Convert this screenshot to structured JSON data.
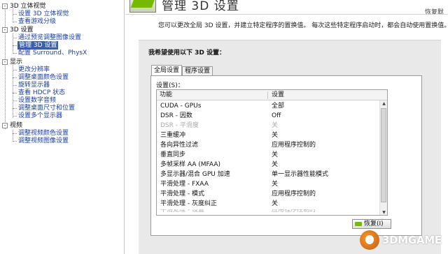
{
  "tree": {
    "categories": [
      {
        "label": "3D 立体视觉",
        "children": [
          "设置 3D 立体视觉",
          "查看游戏分级"
        ]
      },
      {
        "label": "3D 设置",
        "children": [
          "通过预览调整图像设置",
          "管理 3D 设置",
          "配置 Surround、PhysX"
        ]
      },
      {
        "label": "显示",
        "children": [
          "更改分辨率",
          "调整桌面颜色设置",
          "旋转显示器",
          "查看 HDCP 状态",
          "设置数字音频",
          "调整桌面尺寸和位置",
          "设置多个显示器"
        ]
      },
      {
        "label": "视频",
        "children": [
          "调整视频颜色设置",
          "调整视频图像设置"
        ]
      }
    ],
    "toggle": "-",
    "selected": "管理 3D 设置"
  },
  "header": {
    "title": "管理 3D 设置",
    "restore_default": "恢复默",
    "description": "您可以更改全局 3D 设置，并建立特定程序的置换值。 每次这些特定程序启动时，都会自动使用置换值。"
  },
  "panel": {
    "title": "我希望使用以下 3D 设置：",
    "tabs": [
      "全局设置",
      "程序设置"
    ],
    "active_tab": "全局设置",
    "settings_label": "设置(S)：",
    "columns": [
      "功能",
      "设置"
    ],
    "rows": [
      {
        "feature": "CUDA - GPUs",
        "value": "全部",
        "dim": false
      },
      {
        "feature": "DSR - 因数",
        "value": "Off",
        "dim": false
      },
      {
        "feature": "DSR - 平滑度",
        "value": "关",
        "dim": true
      },
      {
        "feature": "三重缓冲",
        "value": "关",
        "dim": false
      },
      {
        "feature": "各向异性过滤",
        "value": "应用程序控制的",
        "dim": false
      },
      {
        "feature": "垂直同步",
        "value": "关",
        "dim": false
      },
      {
        "feature": "多帧采样 AA (MFAA)",
        "value": "关",
        "dim": false
      },
      {
        "feature": "多显示器/混合 GPU 加速",
        "value": "单一显示器性能模式",
        "dim": false
      },
      {
        "feature": "平滑处理 - FXAA",
        "value": "关",
        "dim": false
      },
      {
        "feature": "平滑处理 - 模式",
        "value": "应用程序控制的",
        "dim": false
      },
      {
        "feature": "平滑处理 - 灰度纠正",
        "value": "关",
        "dim": false
      },
      {
        "feature": "平滑处理 - 设置",
        "value": "应用程序控制的",
        "dim": true
      }
    ],
    "restore_button": "恢复(I)"
  },
  "watermark": {
    "text": "3DMGAME"
  },
  "colors": {
    "accent_green": "#76b900",
    "selection": "#3d5fa8",
    "link": "#1a3e9c"
  }
}
